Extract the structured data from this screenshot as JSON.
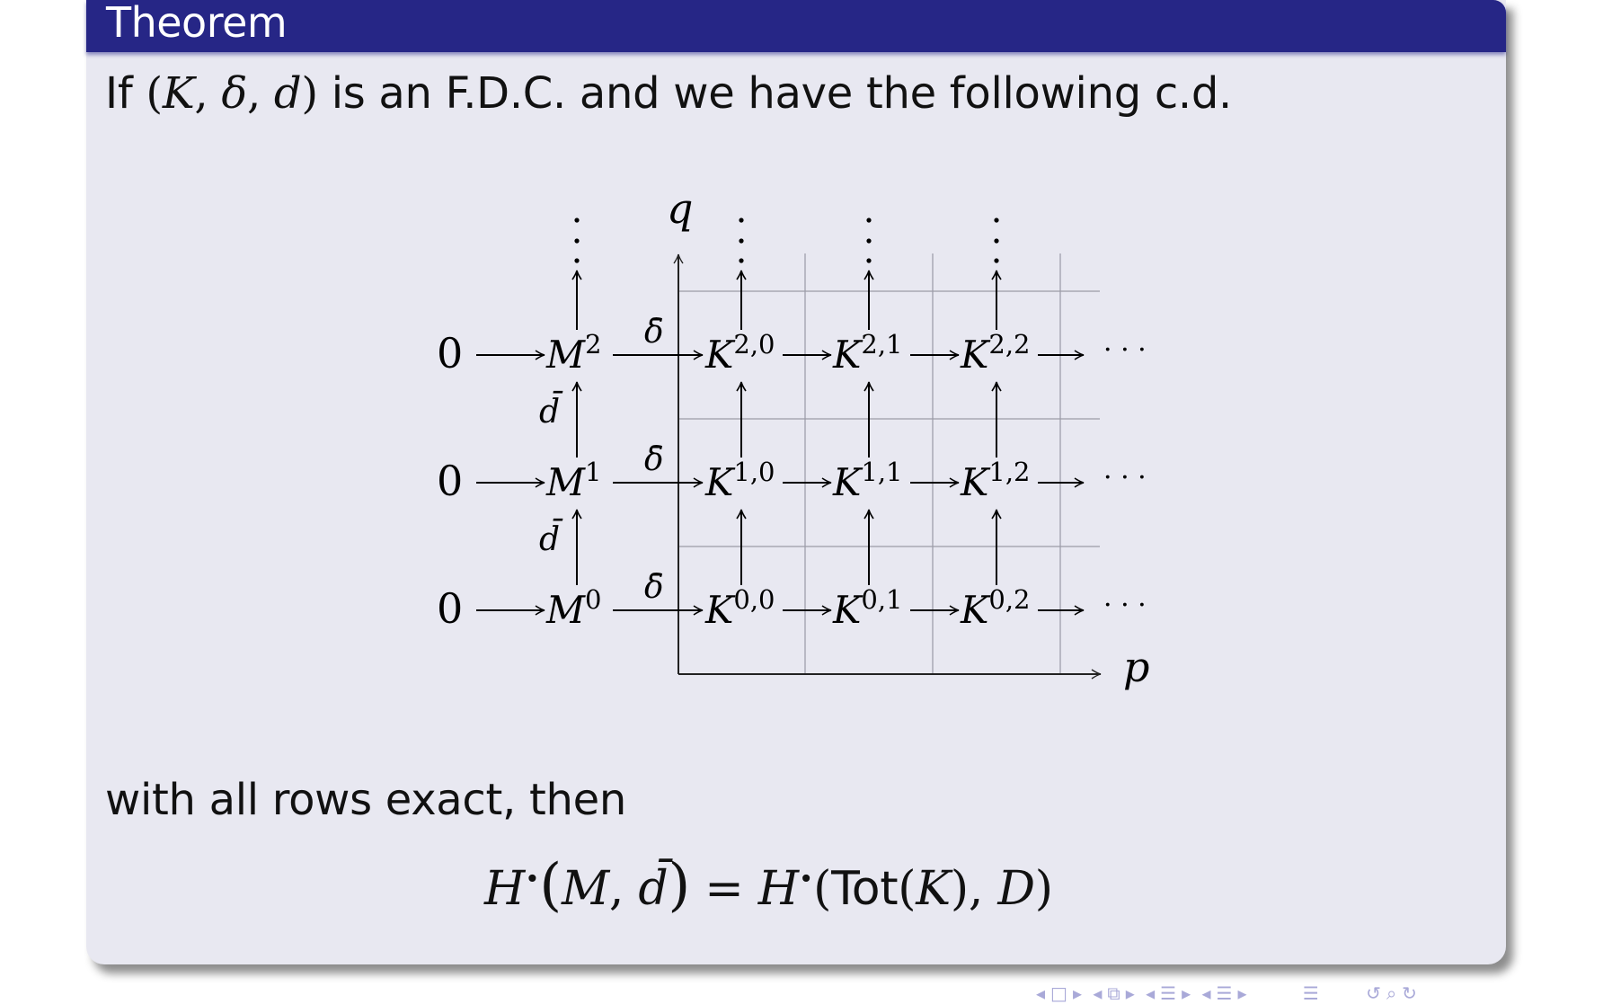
{
  "block": {
    "title": "Theorem",
    "line1": {
      "prefix": "If ",
      "tuple_open": "(",
      "tuple_K": "K",
      "tuple_sep1": ", ",
      "tuple_delta": "δ",
      "tuple_sep2": ", ",
      "tuple_d": "d",
      "tuple_close": ")",
      "suffix": " is an F.D.C. and we have the following c.d."
    },
    "line2": "with all rows exact, then",
    "equation": {
      "lhs_H": "H",
      "bullet": "•",
      "lhs_open": "(",
      "lhs_M": "M",
      "lhs_sep": ", ",
      "lhs_dbar": "d̄",
      "lhs_close": ")",
      "equals": " = ",
      "rhs_H": "H",
      "rhs_open": "(",
      "rhs_tot": "Tot",
      "rhs_tot_open": "(",
      "rhs_K": "K",
      "rhs_tot_close": ")",
      "rhs_sep": ", ",
      "rhs_D": "D",
      "rhs_close": ")"
    }
  },
  "diagram": {
    "axis_q": "q",
    "axis_p": "p",
    "zero": "0",
    "ellipsis": "· · ·",
    "vdots": "⋮",
    "delta_bar": "δ̄",
    "d_bar": "d̄",
    "M_base": "M",
    "M_sups": [
      "2",
      "1",
      "0"
    ],
    "K_base": "K",
    "K_sups": [
      [
        "2,0",
        "2,1",
        "2,2"
      ],
      [
        "1,0",
        "1,1",
        "1,2"
      ],
      [
        "0,0",
        "0,1",
        "0,2"
      ]
    ]
  },
  "navigation": {
    "icons": [
      "◂",
      "□",
      "▸",
      "◂",
      "⧉",
      "▸",
      "◂",
      "☰",
      "▸",
      "◂",
      "☰",
      "▸",
      "☰",
      "↺",
      "⌕",
      "↻"
    ],
    "colors": {
      "nav": "#a9a9d8",
      "title_bar": "#262686",
      "block_bg": "#e8e8f1"
    }
  }
}
